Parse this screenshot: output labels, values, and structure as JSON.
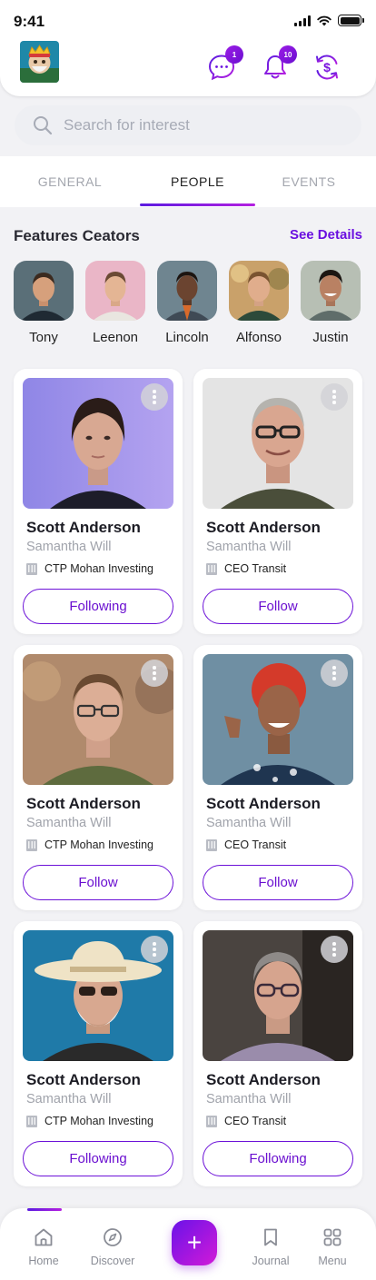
{
  "status_bar": {
    "time": "9:41"
  },
  "header": {
    "messages_badge": "1",
    "notifications_badge": "10"
  },
  "search": {
    "placeholder": "Search for interest"
  },
  "tabs": [
    {
      "label": "GENERAL",
      "active": false
    },
    {
      "label": "PEOPLE",
      "active": true
    },
    {
      "label": "EVENTS",
      "active": false
    }
  ],
  "featured": {
    "title": "Features Ceators",
    "see_details": "See Details",
    "creators": [
      {
        "name": "Tony"
      },
      {
        "name": "Leenon"
      },
      {
        "name": "Lincoln"
      },
      {
        "name": "Alfonso"
      },
      {
        "name": "Justin"
      }
    ]
  },
  "people": [
    {
      "name": "Scott Anderson",
      "subtitle": "Samantha Will",
      "org": "CTP Mohan Investing",
      "button": "Following"
    },
    {
      "name": "Scott Anderson",
      "subtitle": "Samantha Will",
      "org": "CEO Transit",
      "button": "Follow"
    },
    {
      "name": "Scott Anderson",
      "subtitle": "Samantha Will",
      "org": "CTP Mohan Investing",
      "button": "Follow"
    },
    {
      "name": "Scott Anderson",
      "subtitle": "Samantha Will",
      "org": "CEO Transit",
      "button": "Follow"
    },
    {
      "name": "Scott Anderson",
      "subtitle": "Samantha Will",
      "org": "CTP Mohan Investing",
      "button": "Following"
    },
    {
      "name": "Scott Anderson",
      "subtitle": "Samantha Will",
      "org": "CEO Transit",
      "button": "Following"
    }
  ],
  "bottom_nav": {
    "items": [
      {
        "label": "Home",
        "icon": "home-icon",
        "active": true
      },
      {
        "label": "Discover",
        "icon": "compass-icon",
        "active": false
      },
      {
        "label": "Journal",
        "icon": "bookmark-icon",
        "active": false
      },
      {
        "label": "Menu",
        "icon": "grid-icon",
        "active": false
      }
    ],
    "fab_icon": "plus-icon"
  },
  "colors": {
    "accent": "#6a0fd0",
    "accent_gradient_end": "#c21ad8",
    "background": "#f2f2f5"
  }
}
